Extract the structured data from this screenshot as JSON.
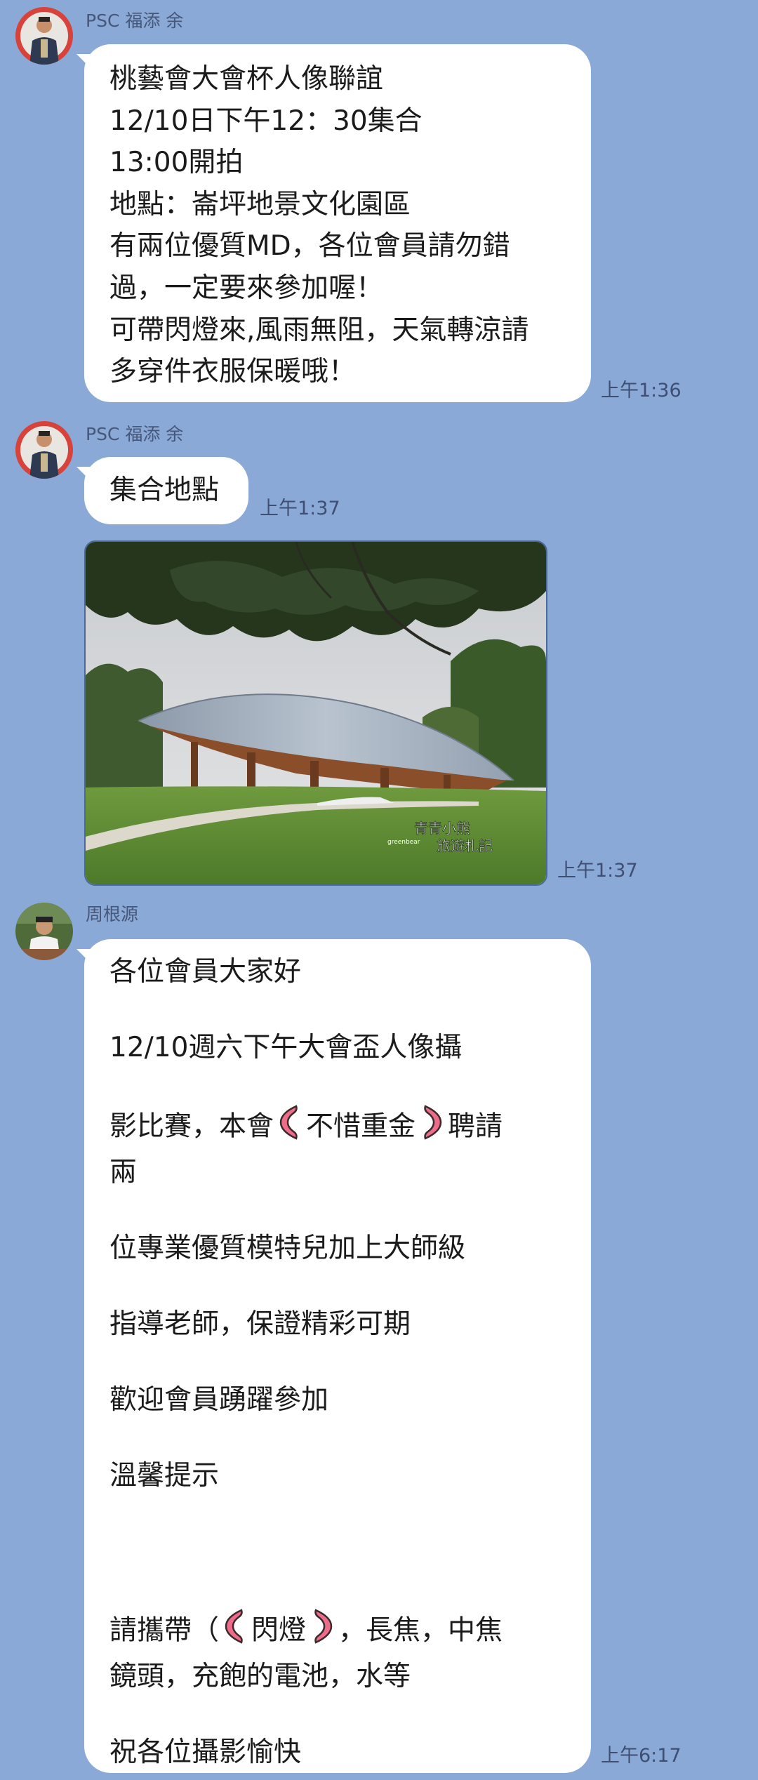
{
  "messages": [
    {
      "sender": "PSC 福添 余",
      "lines": [
        "桃藝會大會杯人像聯誼",
        "12/10日下午12：30集合",
        "13:00開拍",
        "地點：崙坪地景文化園區",
        "有兩位優質MD，各位會員請勿錯",
        "過，一定要來參加喔！",
        "可帶閃燈來,風雨無阻，天氣轉涼請",
        "多穿件衣服保暖哦！"
      ],
      "time": "上午1:36"
    },
    {
      "sender": "PSC 福添 余",
      "text": "集合地點",
      "time": "上午1:37"
    },
    {
      "image": {
        "alt": "",
        "watermark_line1": "青青小熊",
        "watermark_line2": "旅遊札記",
        "watermark_small": "greenbear"
      },
      "time": "上午1:37"
    },
    {
      "sender": "周根源",
      "paragraphs": {
        "p1": "各位會員大家好",
        "p2": "12/10週六下午大會盃人像攝",
        "p3_a": "影比賽，本會",
        "p3_b": "不惜重金",
        "p3_c": "聘請",
        "p3_d": "兩",
        "p4": "位專業優質模特兒加上大師級",
        "p5": "指導老師，保證精彩可期",
        "p6": "歡迎會員踴躍參加",
        "p7": "溫馨提示",
        "p8_a": "請攜帶（",
        "p8_b": "閃燈",
        "p8_c": "，長焦，中焦",
        "p8_d": "鏡頭，充飽的電池，水等",
        "p9": "祝各位攝影愉快"
      },
      "time": "上午6:17"
    }
  ],
  "colors": {
    "background": "#8aa9d6",
    "bubble": "#ffffff",
    "bracket_fill": "#ec6c8a"
  }
}
